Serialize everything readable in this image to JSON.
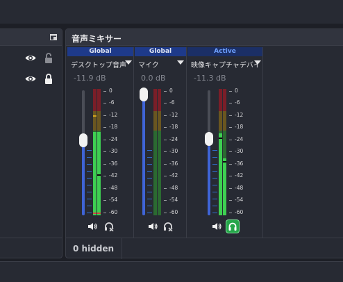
{
  "mixer": {
    "title": "音声ミキサー",
    "hidden_label": "0 hidden",
    "channels": [
      {
        "badge": "Global",
        "name": "デスクトップ音声",
        "db": "-11.9 dB",
        "volume_fraction": 0.56,
        "level_left_db": -33,
        "level_right_db": -42,
        "monitor": "off"
      },
      {
        "badge": "Global",
        "name": "マイク",
        "db": "0.0 dB",
        "volume_fraction": 1.0,
        "level_left_db": -60,
        "level_right_db": -60,
        "monitor": "off"
      },
      {
        "badge": "Active",
        "name": "映像キャプチャデバイ",
        "db": "-11.3 dB",
        "volume_fraction": 0.56,
        "level_left_db": -24,
        "level_right_db": -34,
        "monitor": "on"
      }
    ],
    "scale": [
      "0",
      "-6",
      "-12",
      "-18",
      "-24",
      "-30",
      "-36",
      "-42",
      "-48",
      "-54",
      "-60"
    ]
  },
  "icons": {
    "eye": "eye-icon",
    "lock": "lock-icon",
    "unlock": "unlock-icon",
    "speaker": "speaker-icon",
    "headphones": "headphones-icon",
    "undock": "undock-icon"
  },
  "colors": {
    "badge_global": "#1e3a8a",
    "badge_active": "#6ea0ff",
    "fader_fill": "#3f64d6",
    "meter_green": "#3ecf52",
    "meter_yellow": "#c9a12a",
    "meter_red": "#c0303c",
    "monitor_active": "#25a64a"
  }
}
